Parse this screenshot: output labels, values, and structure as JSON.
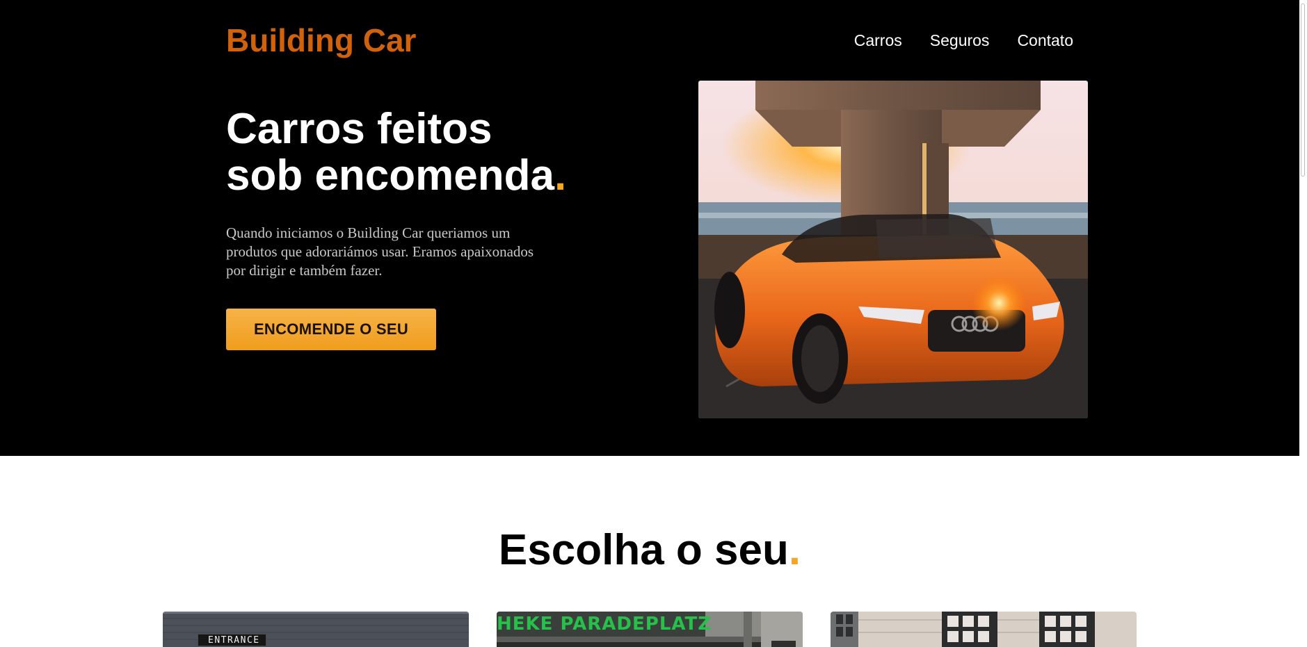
{
  "brand": {
    "name": "Building Car",
    "color": "#d1620a"
  },
  "nav": {
    "items": [
      {
        "label": "Carros"
      },
      {
        "label": "Seguros"
      },
      {
        "label": "Contato"
      }
    ]
  },
  "hero": {
    "title_line1": "Carros feitos",
    "title_line2": "sob encomenda",
    "title_dot": ".",
    "description": "Quando iniciamos o Building Car queriamos um produtos que adorariámos usar. Eramos apaixonados por dirigir e também fazer.",
    "cta_label": "ENCOMENDE O SEU",
    "image_icon": "orange-car-photo",
    "accent_color": "#f5a623"
  },
  "section": {
    "title": "Escolha o seu",
    "title_dot": "."
  },
  "cards": [
    {
      "image_icon": "garage-entrance-photo",
      "sign_text": "ENTRANCE"
    },
    {
      "image_icon": "storefront-photo",
      "sign_text": "HEKE PARADEPLATZ"
    },
    {
      "image_icon": "building-facade-photo"
    }
  ]
}
